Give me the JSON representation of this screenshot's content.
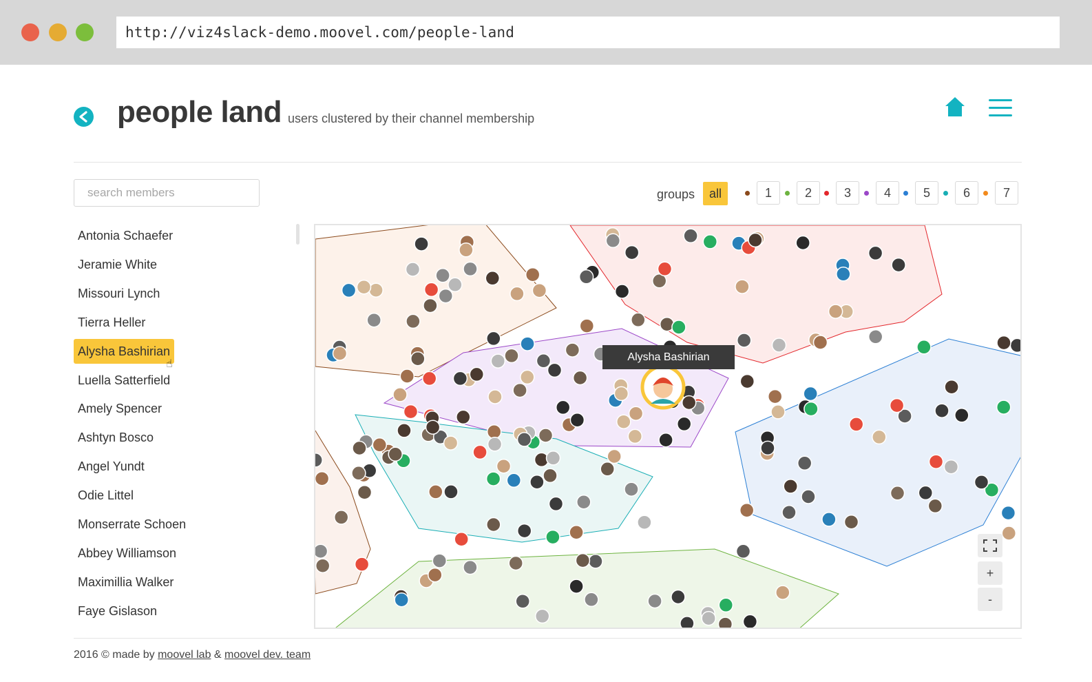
{
  "browser": {
    "url": "http://viz4slack-demo.moovel.com/people-land"
  },
  "header": {
    "title": "people land",
    "subtitle": "users clustered by their channel membership",
    "back_icon": "chevron-left-icon",
    "home_icon": "home-icon",
    "menu_icon": "hamburger-menu-icon",
    "accent": "#13b3c1"
  },
  "search": {
    "placeholder": "search members",
    "value": ""
  },
  "groups": {
    "label": "groups",
    "all_label": "all",
    "items": [
      {
        "label": "1",
        "color": "#8b4a1c"
      },
      {
        "label": "2",
        "color": "#6db33f"
      },
      {
        "label": "3",
        "color": "#e3262b"
      },
      {
        "label": "4",
        "color": "#9b47c8"
      },
      {
        "label": "5",
        "color": "#2b7fd4"
      },
      {
        "label": "6",
        "color": "#19aeb5"
      },
      {
        "label": "7",
        "color": "#f28a1c"
      }
    ]
  },
  "members": [
    "Antonia Schaefer",
    "Jeramie White",
    "Missouri Lynch",
    "Tierra Heller",
    "Alysha Bashirian",
    "Luella Satterfield",
    "Amely Spencer",
    "Ashtyn Bosco",
    "Angel Yundt",
    "Odie Littel",
    "Monserrate Schoen",
    "Abbey Williamson",
    "Maximillia Walker",
    "Faye Gislason"
  ],
  "selected_member": "Alysha Bashirian",
  "map": {
    "tooltip": "Alysha Bashirian",
    "zoom_in_label": "+",
    "zoom_out_label": "-",
    "fullscreen_icon": "fullscreen-icon"
  },
  "footer": {
    "prefix": "2016 © made by",
    "link1": "moovel lab",
    "amp": "&",
    "link2": "moovel dev. team"
  }
}
